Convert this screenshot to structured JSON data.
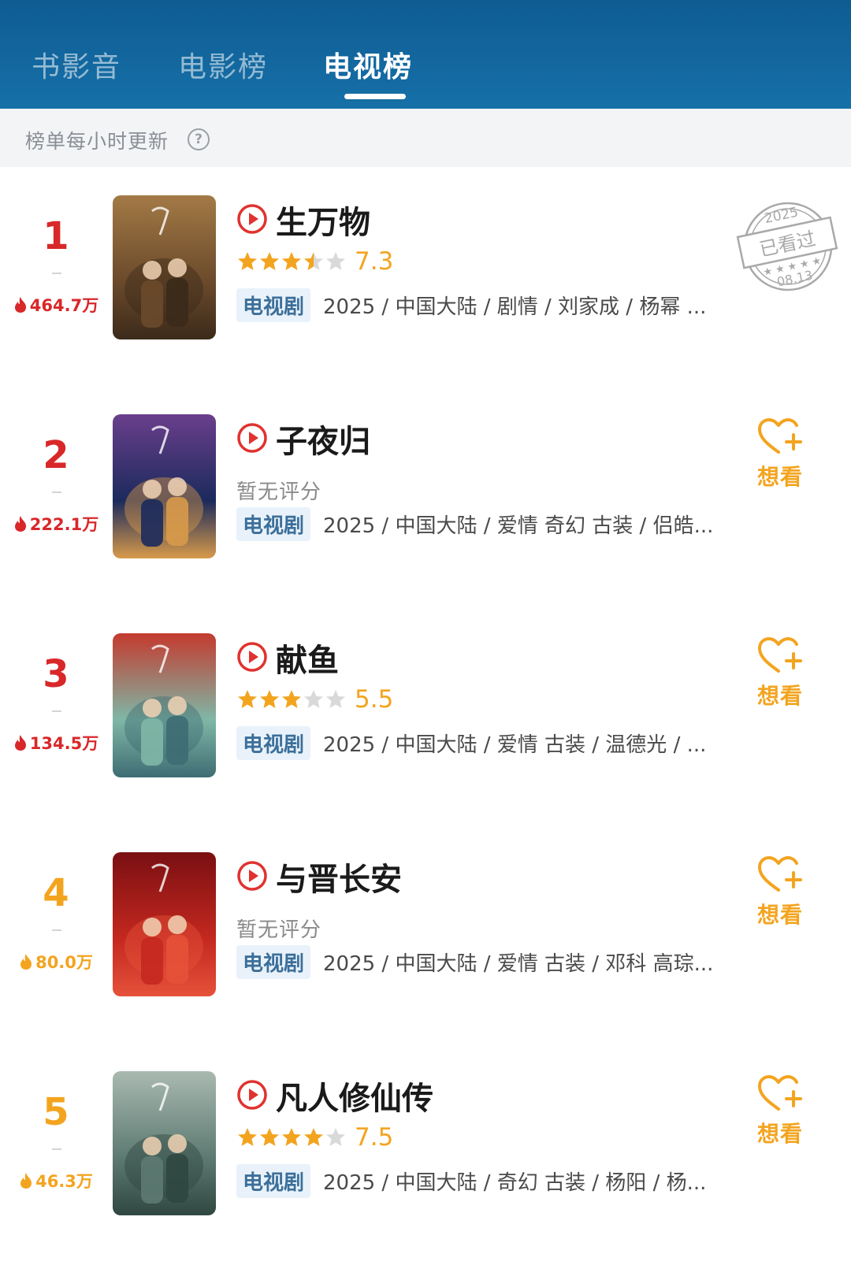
{
  "tabs": [
    {
      "label": "书影音",
      "active": false
    },
    {
      "label": "电影榜",
      "active": false
    },
    {
      "label": "电视榜",
      "active": true
    }
  ],
  "subbar": {
    "text": "榜单每小时更新",
    "help_icon": "question-circle-icon"
  },
  "colors": {
    "header": "#1670a8",
    "rank_red": "#d8282a",
    "accent_orange": "#f3a41f"
  },
  "items": [
    {
      "rank": "1",
      "heat": "464.7万",
      "title": "生万物",
      "rated": true,
      "stars": 3.5,
      "score": "7.3",
      "no_rating": "",
      "type": "电视剧",
      "meta": "2025 / 中国大陆 / 剧情 / 刘家成 / 杨幂 ...",
      "status": "watched",
      "stamp": {
        "year": "2025",
        "label": "已看过",
        "date": "08.13"
      }
    },
    {
      "rank": "2",
      "heat": "222.1万",
      "title": "子夜归",
      "rated": false,
      "stars": 0,
      "score": "",
      "no_rating": "暂无评分",
      "type": "电视剧",
      "meta": "2025 / 中国大陆 / 爱情 奇幻 古装 / 侣皓...",
      "status": "want",
      "want_label": "想看"
    },
    {
      "rank": "3",
      "heat": "134.5万",
      "title": "献鱼",
      "rated": true,
      "stars": 3,
      "score": "5.5",
      "no_rating": "",
      "type": "电视剧",
      "meta": "2025 / 中国大陆 / 爱情 古装 / 温德光 / ...",
      "status": "want",
      "want_label": "想看"
    },
    {
      "rank": "4",
      "heat": "80.0万",
      "title": "与晋长安",
      "rated": false,
      "stars": 0,
      "score": "",
      "no_rating": "暂无评分",
      "type": "电视剧",
      "meta": "2025 / 中国大陆 / 爱情 古装 / 邓科 高琮...",
      "status": "want",
      "want_label": "想看"
    },
    {
      "rank": "5",
      "heat": "46.3万",
      "title": "凡人修仙传",
      "rated": true,
      "stars": 4,
      "score": "7.5",
      "no_rating": "",
      "type": "电视剧",
      "meta": "2025 / 中国大陆 / 奇幻 古装 / 杨阳 / 杨...",
      "status": "want",
      "want_label": "想看"
    }
  ]
}
